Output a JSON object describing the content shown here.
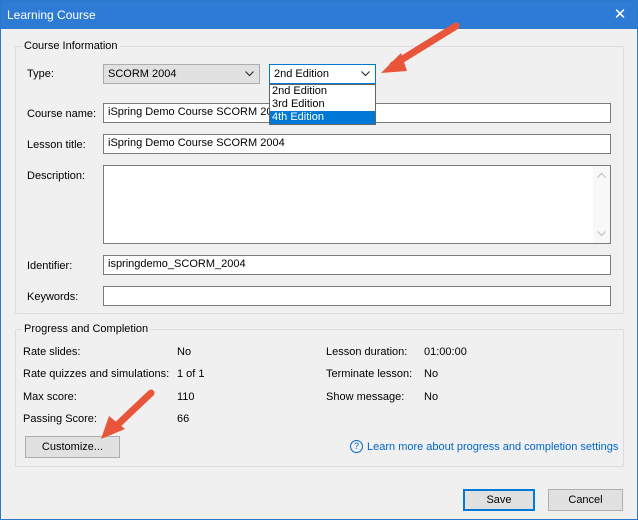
{
  "window": {
    "title": "Learning Course",
    "close_glyph": "✕"
  },
  "course_info": {
    "group_title": "Course Information",
    "type_label": "Type:",
    "type_value": "SCORM 2004",
    "edition_value": "2nd Edition",
    "edition_options": [
      "2nd Edition",
      "3rd Edition",
      "4th Edition"
    ],
    "edition_highlighted": "4th Edition",
    "course_name_label": "Course name:",
    "course_name_value": "iSpring Demo Course SCORM 2004",
    "lesson_title_label": "Lesson title:",
    "lesson_title_value": "iSpring Demo Course SCORM 2004",
    "description_label": "Description:",
    "description_value": "",
    "identifier_label": "Identifier:",
    "identifier_value": "ispringdemo_SCORM_2004",
    "keywords_label": "Keywords:",
    "keywords_value": ""
  },
  "progress": {
    "group_title": "Progress and Completion",
    "rate_slides_label": "Rate slides:",
    "rate_slides_value": "No",
    "rate_quizzes_label": "Rate quizzes and simulations:",
    "rate_quizzes_value": "1 of 1",
    "max_score_label": "Max score:",
    "max_score_value": "110",
    "passing_score_label": "Passing Score:",
    "passing_score_value": "66",
    "lesson_duration_label": "Lesson duration:",
    "lesson_duration_value": "01:00:00",
    "terminate_lesson_label": "Terminate lesson:",
    "terminate_lesson_value": "No",
    "show_message_label": "Show message:",
    "show_message_value": "No",
    "customize_label": "Customize...",
    "learn_more_label": "Learn more about progress and completion settings",
    "help_glyph": "?"
  },
  "footer": {
    "save_label": "Save",
    "cancel_label": "Cancel"
  },
  "colors": {
    "titlebar": "#2d7bd4",
    "accent": "#0078d7",
    "annotation_arrow": "#e8553a",
    "link": "#0066cc"
  }
}
